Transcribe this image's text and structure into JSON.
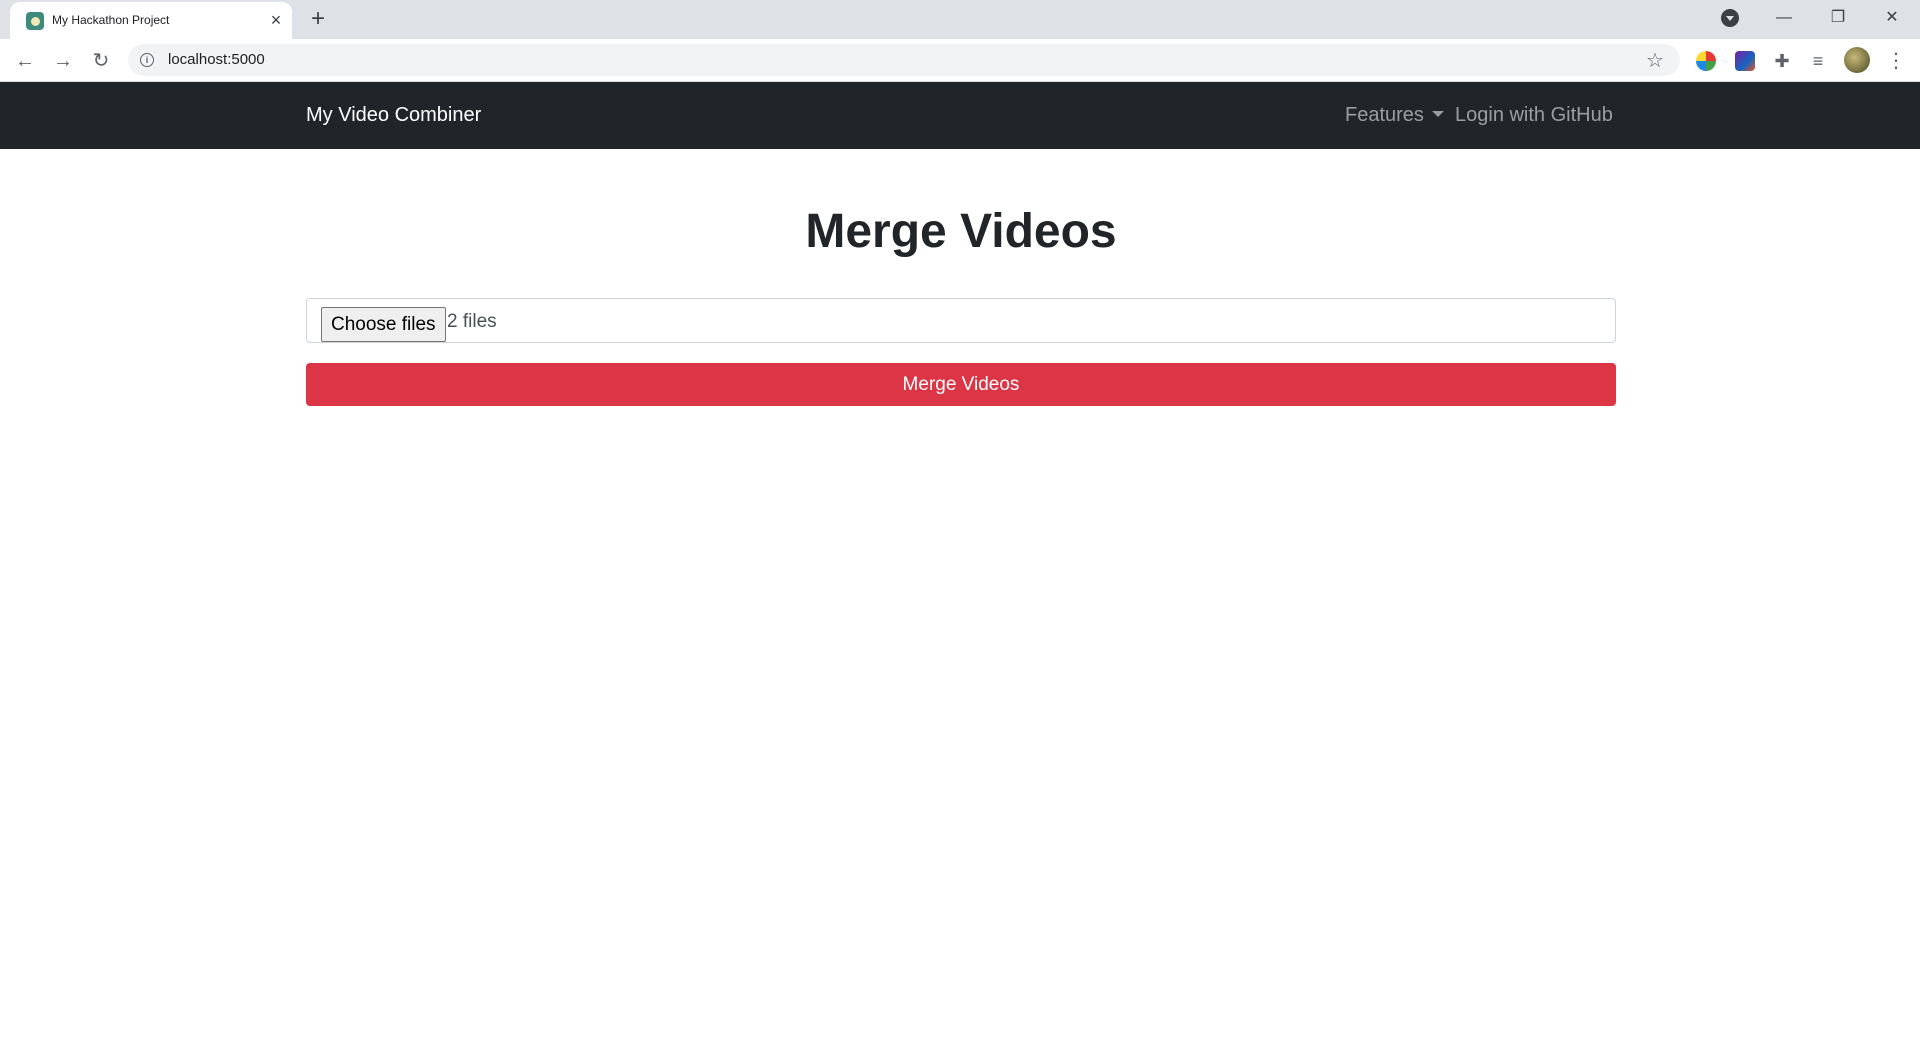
{
  "browser": {
    "tab_title": "My Hackathon Project",
    "tab_close_glyph": "×",
    "new_tab_glyph": "+",
    "url": "localhost:5000",
    "window_controls": {
      "minimize": "—",
      "restore": "❐",
      "close": "✕"
    },
    "icons": [
      "back-icon",
      "forward-icon",
      "reload-icon",
      "info-icon",
      "bookmark-star-icon",
      "extensions-puzzle-icon",
      "reading-list-icon",
      "profile-avatar",
      "menu-dots-icon"
    ]
  },
  "navbar": {
    "brand": "My Video Combiner",
    "features_label": "Features",
    "login_label": "Login with GitHub",
    "background": "#212529"
  },
  "main": {
    "heading": "Merge Videos",
    "file_input": {
      "button_label": "Choose files",
      "status": "2 files"
    },
    "merge_button_label": "Merge Videos",
    "merge_button_color": "#dc3545"
  }
}
